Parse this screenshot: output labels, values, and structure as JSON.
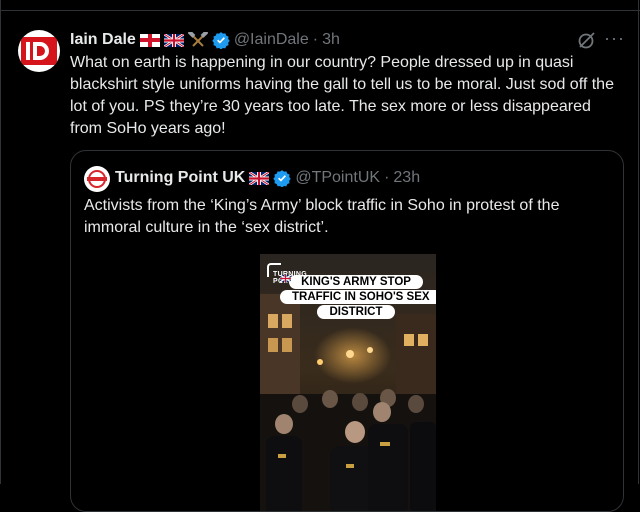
{
  "tweet": {
    "author_name": "Iain Dale",
    "handle": "@IainDale",
    "separator": "·",
    "time": "3h",
    "avatar_icon": "id-logo-icon",
    "text": "What on earth is happening in our country? People dressed up in quasi blackshirt style uniforms having the gall to tell us to be moral. Just sod off the lot of you. PS they’re 30 years too late. The sex more or less disappeared from SoHo years ago!",
    "more_label": "···"
  },
  "quote": {
    "author_name": "Turning Point UK",
    "handle": "@TPointUK",
    "separator": "·",
    "time": "23h",
    "text": "Activists from the ‘King’s Army’ block traffic in Soho in protest of the immoral culture in the ‘sex district’.",
    "video": {
      "logo_line1": "TURNING",
      "logo_line2": "POINT",
      "caption": "KING'S ARMY STOP TRAFFIC IN SOHO'S SEX DISTRICT"
    }
  },
  "colors": {
    "background": "#000000",
    "text": "#e7e9ea",
    "muted": "#71767b",
    "border": "#2f3336",
    "verified": "#1d9bf0",
    "brand_red": "#d6141b"
  }
}
